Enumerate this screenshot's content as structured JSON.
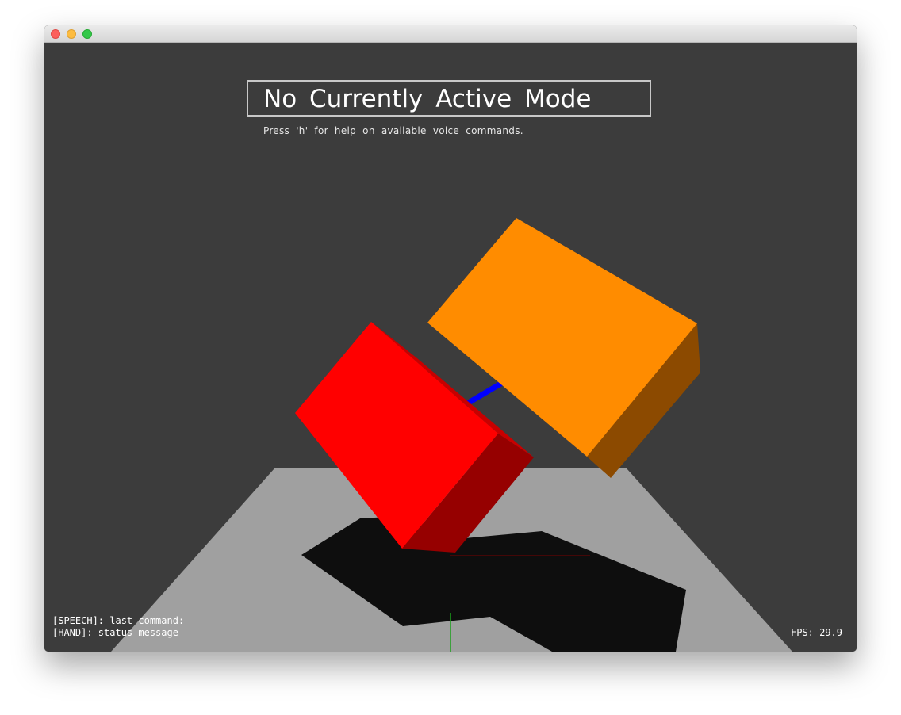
{
  "window": {
    "buttons": [
      "close",
      "minimize",
      "zoom"
    ]
  },
  "overlay": {
    "mode_title": "No Currently Active Mode",
    "help_text": "Press 'h' for help on available voice commands."
  },
  "status": {
    "speech": "[SPEECH]: last command:  - - -",
    "hand": "[HAND]: status message",
    "fps": "FPS: 29.9"
  },
  "scene": {
    "background_color": "#3c3c3c",
    "floor_color": "#a0a0a0",
    "shadow_color": "#0e0e0e",
    "objects": [
      {
        "name": "red-block",
        "front_color": "#ff0000",
        "side_color": "#960000"
      },
      {
        "name": "orange-block",
        "front_color": "#ff8c00",
        "side_color": "#8c4a00"
      },
      {
        "name": "blue-connector",
        "color": "#0000ff"
      }
    ]
  }
}
